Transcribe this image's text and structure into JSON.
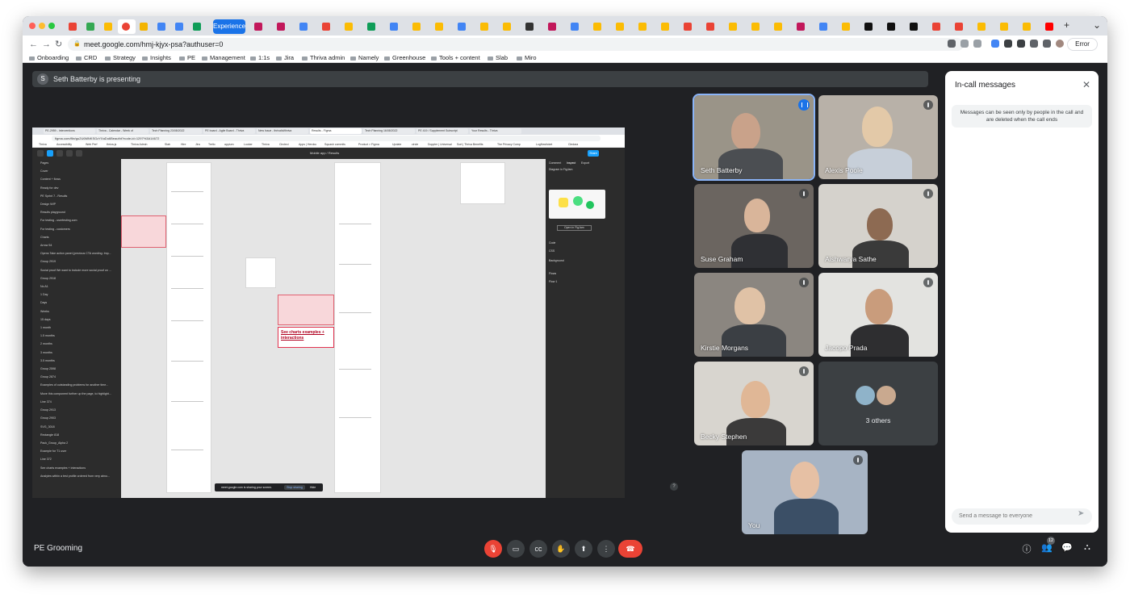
{
  "browser": {
    "url": "meet.google.com/hmj-kjyx-psa?authuser=0",
    "experience_tab": "Experience",
    "profile_button": "Error",
    "bookmarks": [
      "Onboarding",
      "CRD",
      "Strategy",
      "Insights",
      "PE",
      "Management",
      "1:1s",
      "Jira",
      "Thriva admin",
      "Namely",
      "Greenhouse",
      "Tools + content",
      "Slab",
      "Miro"
    ]
  },
  "meet": {
    "presenting_banner": "Seth Batterby is presenting",
    "presenter_initial": "S",
    "meeting_name": "PE Grooming",
    "participants_count": "12",
    "others_label": "3 others",
    "tiles": [
      {
        "name": "Seth Batterby"
      },
      {
        "name": "Alexis Poole"
      },
      {
        "name": "Suse Graham"
      },
      {
        "name": "Aishwarya Sathe"
      },
      {
        "name": "Kirstie Morgans"
      },
      {
        "name": "Jacopo Prada"
      },
      {
        "name": "Becky Stephen"
      },
      {
        "name": "You"
      }
    ]
  },
  "panel": {
    "title": "In-call messages",
    "info": "Messages can be seen only by people in the call and are deleted when the call ends",
    "send_placeholder": "Send a message to everyone"
  },
  "shared_screen": {
    "url": "figma.com/file/gu2U6MNKSGzYXaDu6Beautht?node-id=1297%3A14672",
    "file_title": "Mobile app / Results",
    "share_label": "Share",
    "sharing_notice": "meet.google.com is sharing your screen.",
    "stop_sharing": "Stop sharing",
    "hide": "Hide",
    "red_box": "See charts examples + interactions",
    "right_tabs": [
      "Comment",
      "Inspect",
      "Export"
    ],
    "right_texts": [
      "Diagram in FigJam",
      "Open in FigJam",
      "Code",
      "CSS",
      "Background",
      "Flows",
      "Flow 1"
    ],
    "pages": [
      "Pages",
      "Cover",
      "Content + flows",
      "Ready for dev",
      "PE Sprint 7 - Results",
      "Design WIP",
      "Results playground",
      "For testing - userfesting.com",
      "For testing - customers",
      "Charts",
      "Arrow 54",
      "Opens Take action panel (previous CTA wording: Imp...",
      "Group 2919",
      "Social proof We want to include more social proof on ...",
      "Group 2918",
      "No A1",
      "1 Day",
      "Days",
      "Weeks",
      "15 days",
      "1 month",
      "1.5 months",
      "2 months",
      "3 months",
      "3.5 months",
      "Group 2598",
      "Group 2874",
      "Examples of outstanding problems for another time...",
      "Move this component further up the page, to highlight...",
      "Line 374",
      "Group 2913",
      "Group 2903",
      "SVG_3018",
      "Rectangle 818",
      "Pack_Group_Alpha 2",
      "Example for T1 user",
      "Line 372",
      "See charts examples + interactions",
      "Analytes within a test profile ordered from very abno..."
    ],
    "tabs": [
      "PE-2959 - Interventions",
      "Thriva - Calendar - Week of",
      "Tech Planning 23/08/2022",
      "PE board - Agile Board - Thriva",
      "New Issue - thrivaltd/thriva",
      "Results - Figma",
      "Tech Planning 16/08/2022",
      "PE 419 / Supplement Subscript",
      "Your Results - Thriva"
    ],
    "bookmarks": [
      "Thriva",
      "Accessibility",
      "Web Perf",
      "thriva-js",
      "Thriva Admin",
      "Slab",
      "Hire",
      "Jira",
      "Trello",
      "appium",
      "Looker",
      "Thriva",
      "Circleci",
      "Apps | Heroku",
      "Squash commits",
      "Product > Figma",
      "Update",
      "circle",
      "Doppler | Universal",
      "Sort | Thriva Benefits",
      "The Privacy Comp",
      "Logflowticket",
      "Cledara"
    ]
  },
  "colors": {
    "meet_bg": "#202124",
    "tile_bg": "#3c4043",
    "hangup": "#ea4335",
    "accent_blue": "#1a73e8"
  }
}
